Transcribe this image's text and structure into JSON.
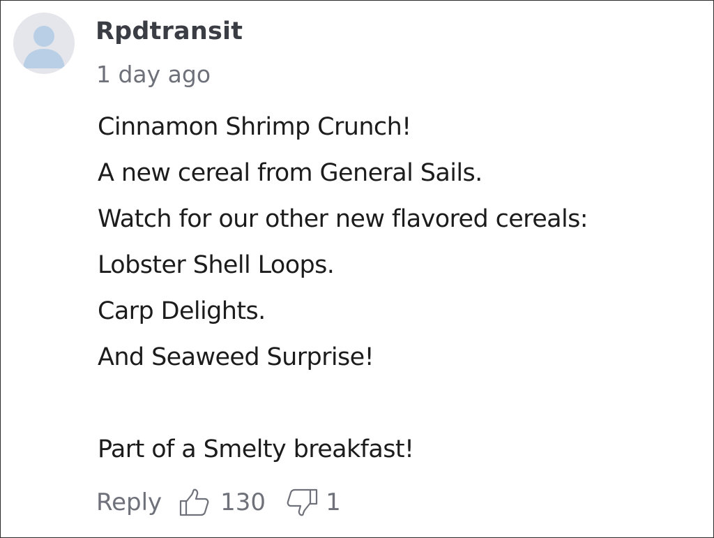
{
  "comment": {
    "author": "Rpdtransit",
    "timestamp": "1 day ago",
    "lines": [
      "Cinnamon Shrimp Crunch!",
      "A new cereal from General Sails.",
      "Watch for our other new flavored cereals:",
      "Lobster Shell Loops.",
      "Carp Delights.",
      "And Seaweed Surprise!",
      "",
      "Part of a Smelty breakfast!"
    ],
    "actions": {
      "reply_label": "Reply",
      "upvote_icon": "thumbs-up-icon",
      "upvote_count": "130",
      "downvote_icon": "thumbs-down-icon",
      "downvote_count": "1"
    }
  },
  "colors": {
    "avatar_bg": "#e4e6eb",
    "avatar_figure": "#b9cfe6",
    "author": "#3a3d44",
    "muted": "#6e7179",
    "text": "#1c1c1c"
  }
}
